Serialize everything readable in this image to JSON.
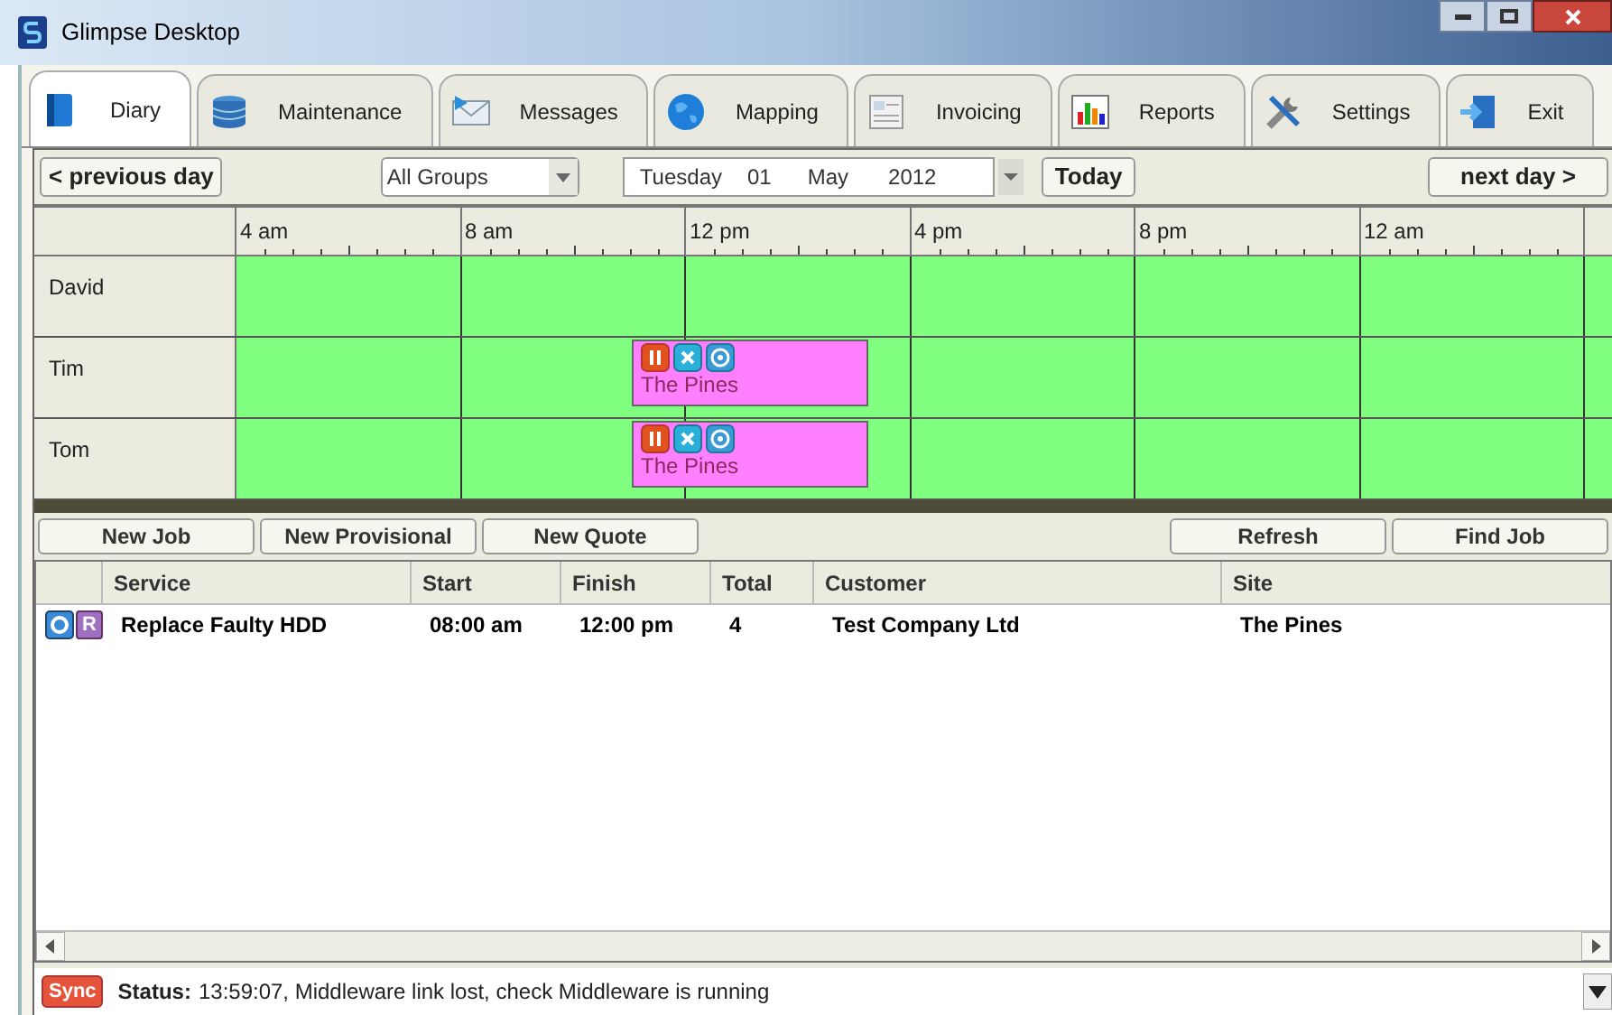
{
  "window": {
    "title": "Glimpse Desktop"
  },
  "tabs": [
    {
      "label": "Diary",
      "selected": true
    },
    {
      "label": "Maintenance",
      "selected": false
    },
    {
      "label": "Messages",
      "selected": false
    },
    {
      "label": "Mapping",
      "selected": false
    },
    {
      "label": "Invoicing",
      "selected": false
    },
    {
      "label": "Reports",
      "selected": false
    },
    {
      "label": "Settings",
      "selected": false
    },
    {
      "label": "Exit",
      "selected": false
    }
  ],
  "toolbar": {
    "previous": "< previous day",
    "group": "All Groups",
    "date": {
      "weekday": "Tuesday",
      "day": "01",
      "month": "May",
      "year": "2012"
    },
    "today": "Today",
    "next": "next day >"
  },
  "timeline": {
    "hours": [
      "4 am",
      "8 am",
      "12 pm",
      "4 pm",
      "8 pm",
      "12 am"
    ],
    "resources": [
      {
        "name": "David"
      },
      {
        "name": "Tim",
        "events": [
          {
            "label": "The Pines"
          }
        ]
      },
      {
        "name": "Tom",
        "events": [
          {
            "label": "The Pines"
          }
        ]
      }
    ]
  },
  "actions_left": [
    "New Job",
    "New Provisional",
    "New Quote"
  ],
  "actions_right": [
    "Refresh",
    "Find Job"
  ],
  "table": {
    "columns": [
      "Service",
      "Start",
      "Finish",
      "Total",
      "Customer",
      "Site"
    ],
    "rows": [
      {
        "flag": "R",
        "cells": [
          "Replace Faulty HDD",
          "08:00 am",
          "12:00 pm",
          "4",
          "Test Company Ltd",
          "The Pines"
        ]
      }
    ]
  },
  "status_bar": {
    "badge": "Sync",
    "label": "Status:",
    "message": "13:59:07, Middleware link lost, check Middleware is running"
  }
}
